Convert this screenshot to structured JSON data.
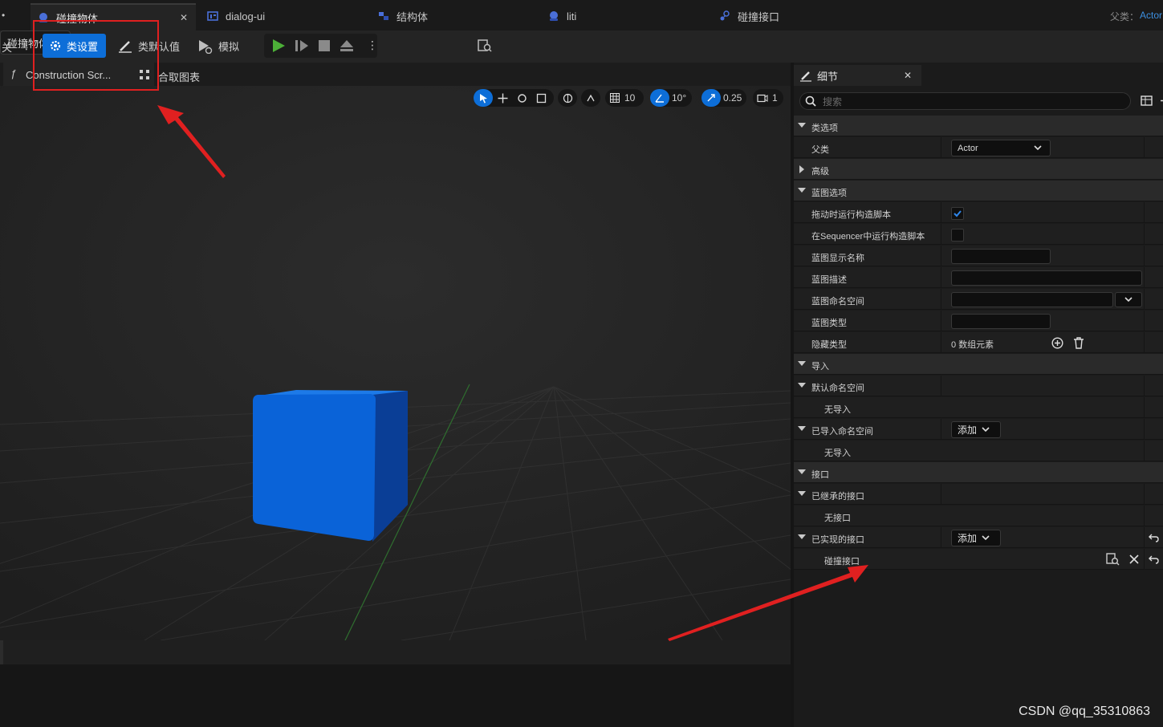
{
  "tabs": {
    "partial_left": "•",
    "items": [
      {
        "label": "碰撞物体"
      },
      {
        "label": "dialog-ui"
      },
      {
        "label": "结构体"
      },
      {
        "label": "liti"
      },
      {
        "label": "碰撞接口"
      }
    ],
    "parent_label": "父类：",
    "parent_value": "Actor"
  },
  "toolbar": {
    "partial_label": "关",
    "class_settings": "类设置",
    "class_defaults": "类默认值",
    "simulate": "模拟",
    "debug_object": "碰撞物体"
  },
  "graph_tabs": {
    "construction": "Construction Scr...",
    "event_graph": "合取图表"
  },
  "viewport_toolbar": {
    "grid_snap": "10",
    "rotation_snap": "10°",
    "scale_snap": "0.25",
    "camera_speed": "1"
  },
  "details": {
    "tab_title": "细节",
    "search_placeholder": "搜索",
    "rows": [
      {
        "type": "cat",
        "label": "类选项",
        "arrow": "down"
      },
      {
        "type": "prop",
        "label": "父类",
        "value": "Actor"
      },
      {
        "type": "cat",
        "label": "高级",
        "arrow": "right"
      },
      {
        "type": "cat",
        "label": "蓝图选项",
        "arrow": "down"
      },
      {
        "type": "prop",
        "label": "拖动时运行构造脚本",
        "checked": true
      },
      {
        "type": "prop",
        "label": "在Sequencer中运行构造脚本",
        "checked": false
      },
      {
        "type": "prop",
        "label": "蓝图显示名称"
      },
      {
        "type": "prop",
        "label": "蓝图描述"
      },
      {
        "type": "prop",
        "label": "蓝图命名空间"
      },
      {
        "type": "prop",
        "label": "蓝图类型"
      },
      {
        "type": "prop",
        "label": "隐藏类型",
        "value": "0 数组元素"
      },
      {
        "type": "cat",
        "label": "导入",
        "arrow": "down"
      },
      {
        "type": "prop",
        "label": "默认命名空间",
        "arrow": "down"
      },
      {
        "type": "prop",
        "label": "无导入"
      },
      {
        "type": "prop",
        "label": "已导入命名空间",
        "arrow": "down",
        "button": "添加"
      },
      {
        "type": "prop",
        "label": "无导入"
      },
      {
        "type": "cat",
        "label": "接口",
        "arrow": "down"
      },
      {
        "type": "prop",
        "label": "已继承的接口",
        "arrow": "down"
      },
      {
        "type": "prop",
        "label": "无接口"
      },
      {
        "type": "prop",
        "label": "已实现的接口",
        "arrow": "down",
        "button": "添加"
      },
      {
        "type": "prop",
        "label": "碰撞接口"
      }
    ]
  },
  "watermark": "CSDN @qq_35310863",
  "colors": {
    "accent": "#0d6ed8",
    "cube": "#0a63d8",
    "annotation": "#e02020"
  }
}
